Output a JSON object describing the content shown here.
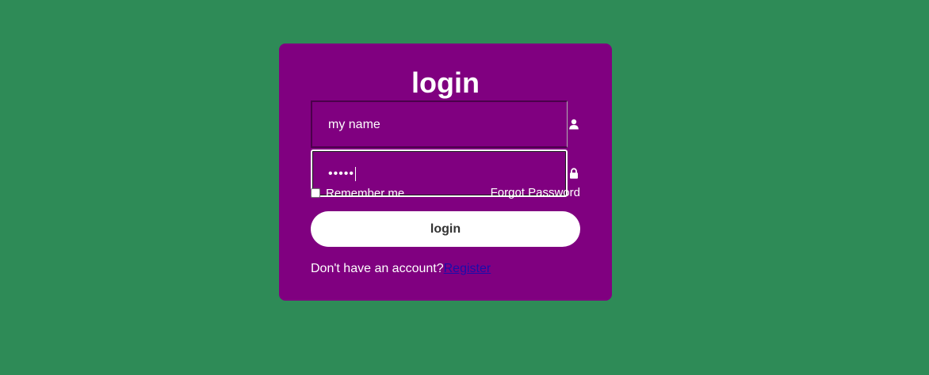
{
  "page": {
    "background_color": "#2e8b57",
    "card_color": "#800080"
  },
  "login_form": {
    "title": "login",
    "username": {
      "value": "my name",
      "icon": "user-icon"
    },
    "password": {
      "masked_value": "•••••",
      "icon": "lock-icon"
    },
    "remember_label": "Remember me",
    "remember_checked": false,
    "forgot_label": "Forgot Password",
    "submit_label": "login",
    "no_account_text": "Don't have an account?",
    "register_label": "Register"
  }
}
